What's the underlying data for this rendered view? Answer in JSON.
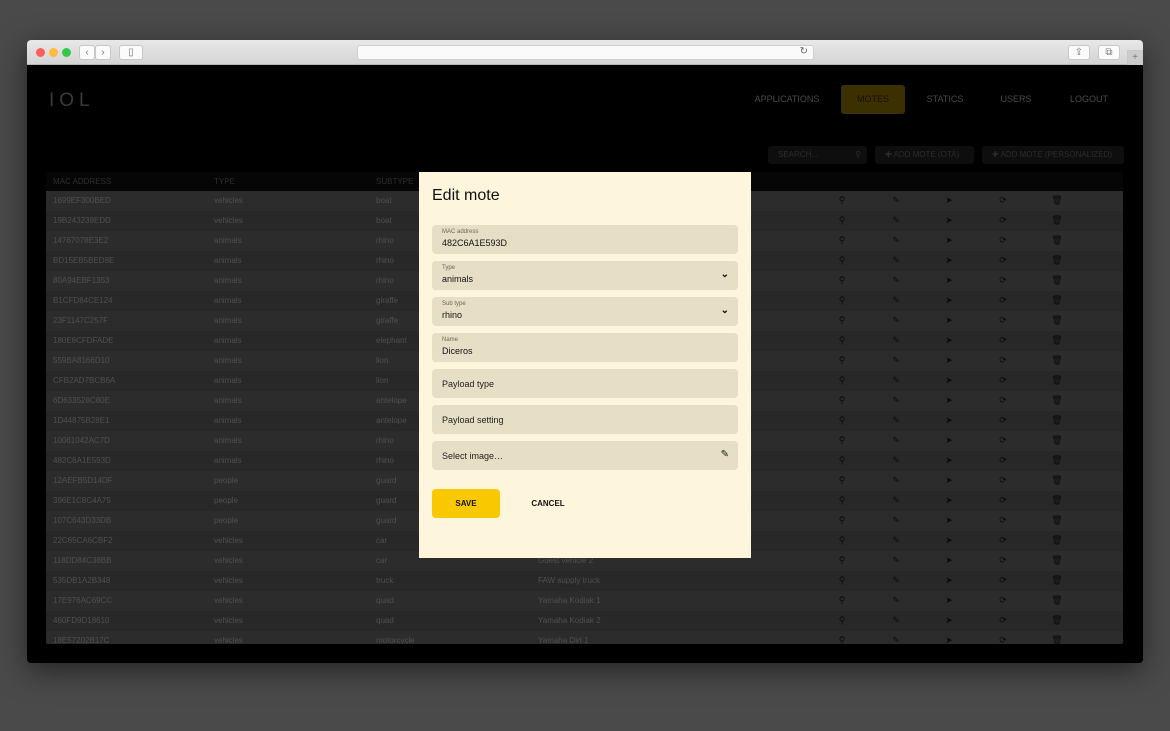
{
  "browser": {
    "back": "‹",
    "forward": "›",
    "sidebar": "▯",
    "reload": "↻",
    "share": "⇪",
    "tabs": "⧉",
    "new_tab": "+"
  },
  "header": {
    "logo": "IOL",
    "nav": [
      {
        "label": "APPLICATIONS"
      },
      {
        "label": "MOTES",
        "active": true
      },
      {
        "label": "STATICS"
      },
      {
        "label": "USERS"
      },
      {
        "label": "LOGOUT"
      }
    ]
  },
  "toolbar": {
    "search_placeholder": "SEARCH...",
    "add_ota": "ADD MOTE (OTA)",
    "add_personalized": "ADD MOTE (PERSONALIZED)"
  },
  "table": {
    "headers": [
      "MAC ADDRESS",
      "TYPE",
      "SUBTYPE"
    ],
    "rows": [
      [
        "1699EF300BED",
        "vehicles",
        "boat",
        ""
      ],
      [
        "19B243239EDD",
        "vehicles",
        "boat",
        ""
      ],
      [
        "14767078E3E2",
        "animals",
        "rhino",
        ""
      ],
      [
        "BD15EB5BED8E",
        "animals",
        "rhino",
        ""
      ],
      [
        "80A94EBF1353",
        "animals",
        "rhino",
        ""
      ],
      [
        "B1CFD84CE124",
        "animals",
        "giraffe",
        ""
      ],
      [
        "23F1147C257F",
        "animals",
        "giraffe",
        ""
      ],
      [
        "180E6CFDFADE",
        "animals",
        "elephant",
        ""
      ],
      [
        "559BA8166D10",
        "animals",
        "lion",
        ""
      ],
      [
        "CFB2AD7BCB6A",
        "animals",
        "lion",
        ""
      ],
      [
        "6D633528C80E",
        "animals",
        "antelope",
        ""
      ],
      [
        "1D44875B28E1",
        "animals",
        "antelope",
        ""
      ],
      [
        "10061042AC7D",
        "animals",
        "rhino",
        ""
      ],
      [
        "482C6A1E593D",
        "animals",
        "rhino",
        ""
      ],
      [
        "12AEFB5D14DF",
        "people",
        "guard",
        ""
      ],
      [
        "396E1C8C4A75",
        "people",
        "guard",
        ""
      ],
      [
        "107C643D33DB",
        "people",
        "guard",
        ""
      ],
      [
        "22C65CA6CBF2",
        "vehicles",
        "car",
        ""
      ],
      [
        "118DD84C38BB",
        "vehicles",
        "car",
        "Guest vehicle 2"
      ],
      [
        "535DB1A2B348",
        "vehicles",
        "truck",
        "FAW supply truck"
      ],
      [
        "17E976AC69CC",
        "vehicles",
        "quad",
        "Yamaha Kodiak 1"
      ],
      [
        "460FD9D18610",
        "vehicles",
        "quad",
        "Yamaha Kodiak 2"
      ],
      [
        "18E57202B17C",
        "vehicles",
        "motorcycle",
        "Yamaha Dirt 1"
      ]
    ]
  },
  "dialog": {
    "title": "Edit mote",
    "mac_label": "MAC address",
    "mac_value": "482C6A1E593D",
    "type_label": "Type",
    "type_value": "animals",
    "subtype_label": "Sub type",
    "subtype_value": "rhino",
    "name_label": "Name",
    "name_value": "Diceros",
    "payload_type": "Payload type",
    "payload_setting": "Payload setting",
    "select_image": "Select image…",
    "save": "SAVE",
    "cancel": "CANCEL"
  },
  "colors": {
    "accent": "#f9c800",
    "dialog_bg": "#fdf6dc",
    "field_bg": "#e6dfc6"
  }
}
